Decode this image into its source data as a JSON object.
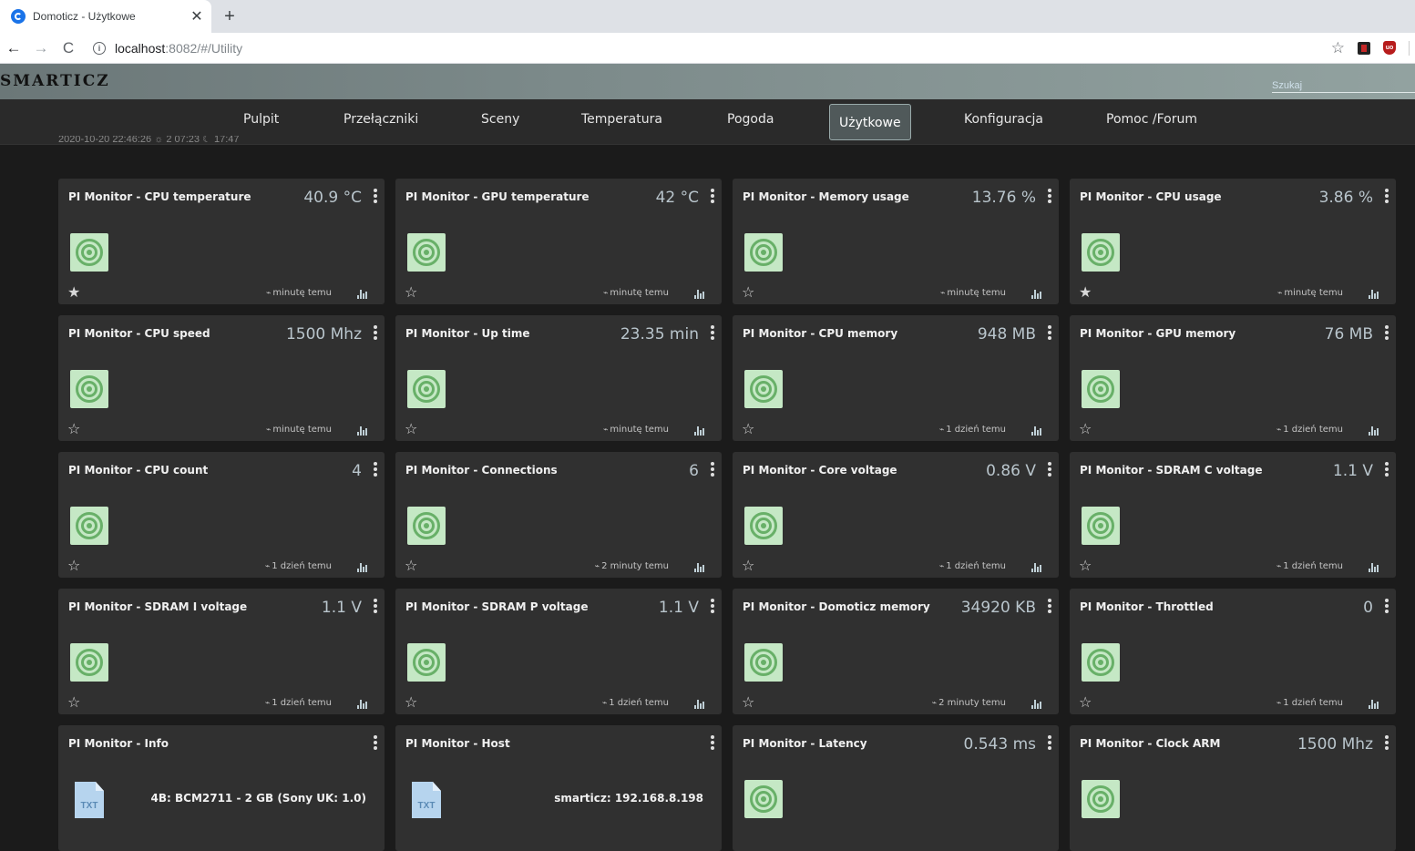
{
  "browser": {
    "tab_title": "Domoticz - Użytkowe",
    "tab_close": "✕",
    "new_tab": "+",
    "back": "←",
    "forward": "→",
    "reload": "C",
    "url_host": "localhost",
    "url_rest": ":8082/#/Utility"
  },
  "header": {
    "logo": "SMARTICZ",
    "search_placeholder": "Szukaj"
  },
  "menu": {
    "items": [
      {
        "label": "Pulpit"
      },
      {
        "label": "Przełączniki"
      },
      {
        "label": "Sceny"
      },
      {
        "label": "Temperatura"
      },
      {
        "label": "Pogoda"
      },
      {
        "label": "Użytkowe",
        "active": true
      },
      {
        "label": "Konfiguracja"
      },
      {
        "label": "Pomoc /Forum"
      }
    ]
  },
  "date_strip": "2020-10-20 22:46:26 ☼ 2 07:23 ☾ 17:47",
  "devices": [
    {
      "name": "PI Monitor - CPU temperature",
      "value": "40.9 °C",
      "updated": "minutę temu",
      "fav": true,
      "icon": "counter-icon"
    },
    {
      "name": "PI Monitor - GPU temperature",
      "value": "42 °C",
      "updated": "minutę temu",
      "fav": false,
      "icon": "counter-icon"
    },
    {
      "name": "PI Monitor - Memory usage",
      "value": "13.76 %",
      "updated": "minutę temu",
      "fav": false,
      "icon": "counter-icon"
    },
    {
      "name": "PI Monitor - CPU usage",
      "value": "3.86 %",
      "updated": "minutę temu",
      "fav": true,
      "icon": "counter-icon"
    },
    {
      "name": "PI Monitor - CPU speed",
      "value": "1500 Mhz",
      "updated": "minutę temu",
      "fav": false,
      "icon": "counter-icon"
    },
    {
      "name": "PI Monitor - Up time",
      "value": "23.35 min",
      "updated": "minutę temu",
      "fav": false,
      "icon": "counter-icon"
    },
    {
      "name": "PI Monitor - CPU memory",
      "value": "948 MB",
      "updated": "1 dzień temu",
      "fav": false,
      "icon": "counter-icon"
    },
    {
      "name": "PI Monitor - GPU memory",
      "value": "76 MB",
      "updated": "1 dzień temu",
      "fav": false,
      "icon": "counter-icon"
    },
    {
      "name": "PI Monitor - CPU count",
      "value": "4",
      "updated": "1 dzień temu",
      "fav": false,
      "icon": "counter-icon"
    },
    {
      "name": "PI Monitor - Connections",
      "value": "6",
      "updated": "2 minuty temu",
      "fav": false,
      "icon": "counter-icon"
    },
    {
      "name": "PI Monitor - Core voltage",
      "value": "0.86 V",
      "updated": "1 dzień temu",
      "fav": false,
      "icon": "counter-icon"
    },
    {
      "name": "PI Monitor - SDRAM C voltage",
      "value": "1.1 V",
      "updated": "1 dzień temu",
      "fav": false,
      "icon": "counter-icon"
    },
    {
      "name": "PI Monitor - SDRAM I voltage",
      "value": "1.1 V",
      "updated": "1 dzień temu",
      "fav": false,
      "icon": "counter-icon"
    },
    {
      "name": "PI Monitor - SDRAM P voltage",
      "value": "1.1 V",
      "updated": "1 dzień temu",
      "fav": false,
      "icon": "counter-icon"
    },
    {
      "name": "PI Monitor - Domoticz memory",
      "value": "34920 KB",
      "updated": "2 minuty temu",
      "fav": false,
      "icon": "counter-icon"
    },
    {
      "name": "PI Monitor - Throttled",
      "value": "0",
      "updated": "1 dzień temu",
      "fav": false,
      "icon": "counter-icon"
    },
    {
      "name": "PI Monitor - Info",
      "value": "",
      "text": "4B: BCM2711 - 2 GB (Sony UK: 1.0)",
      "icon": "txt-file-icon",
      "icon_label": "TXT"
    },
    {
      "name": "PI Monitor - Host",
      "value": "",
      "text": "smarticz: 192.168.8.198",
      "icon": "txt-file-icon",
      "icon_label": "TXT"
    },
    {
      "name": "PI Monitor - Latency",
      "value": "0.543 ms",
      "icon": "counter-icon"
    },
    {
      "name": "PI Monitor - Clock ARM",
      "value": "1500 Mhz",
      "icon": "counter-icon"
    }
  ]
}
